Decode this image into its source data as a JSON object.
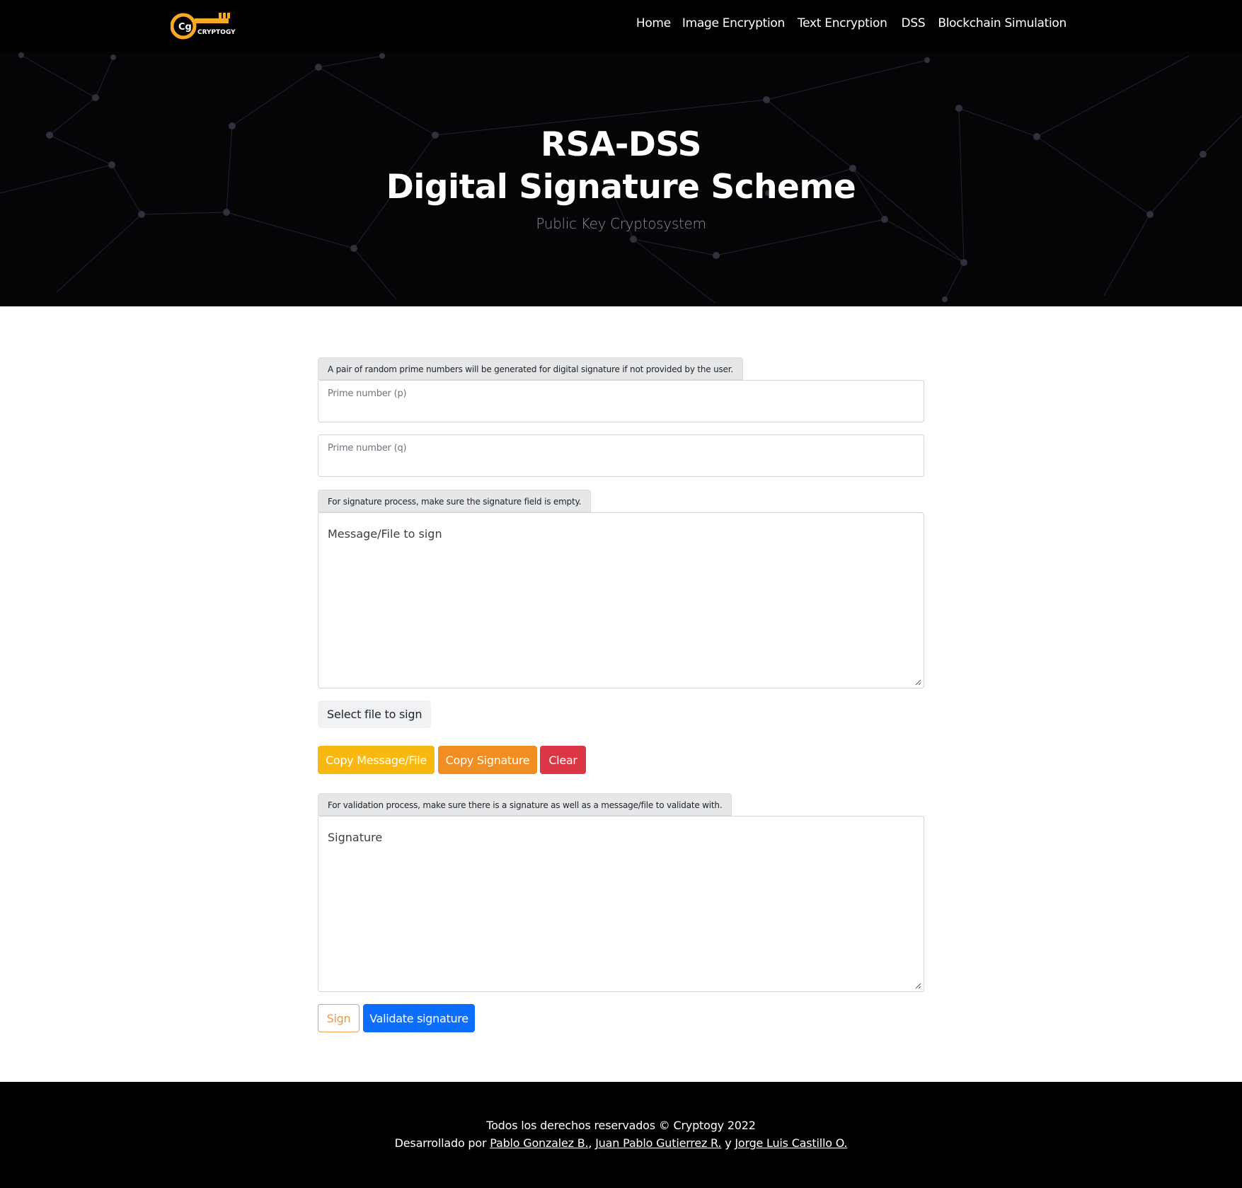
{
  "navbar": {
    "logo_text": "CRYPTOGY",
    "links": [
      "Home",
      "Image Encryption",
      "Text Encryption",
      "DSS",
      "Blockchain Simulation"
    ]
  },
  "hero": {
    "title_line1": "RSA-DSS",
    "title_line2": "Digital Signature Scheme",
    "subtitle": "Public Key Cryptosystem"
  },
  "form": {
    "primes_hint": "A pair of random prime numbers will be generated for digital signature if not provided by the user.",
    "p_label": "Prime number (p)",
    "p_value": "",
    "q_label": "Prime number (q)",
    "q_value": "",
    "sign_hint": "For signature process, make sure the signature field is empty.",
    "message_placeholder": "Message/File to sign",
    "file_button": "Select file to sign",
    "copy_message_button": "Copy Message/File",
    "copy_signature_button": "Copy Signature",
    "clear_button": "Clear",
    "validate_hint": "For validation process, make sure there is a signature as well as a message/file to validate with.",
    "signature_placeholder": "Signature",
    "sign_button": "Sign",
    "validate_button": "Validate signature"
  },
  "footer": {
    "rights": "Todos los derechos reservados © Cryptogy 2022",
    "developed_by": "Desarrollado por",
    "author1": "Pablo Gonzalez B.",
    "sep1": ",",
    "author2": "Juan Pablo Gutierrez R.",
    "sep2": "y",
    "author3": "Jorge Luis Castillo O."
  },
  "colors": {
    "brand_orange": "#f9a825",
    "btn_yellow": "#f9b80f",
    "btn_orange": "#f08d23",
    "btn_red": "#dc3545",
    "btn_blue": "#0d6efd"
  }
}
